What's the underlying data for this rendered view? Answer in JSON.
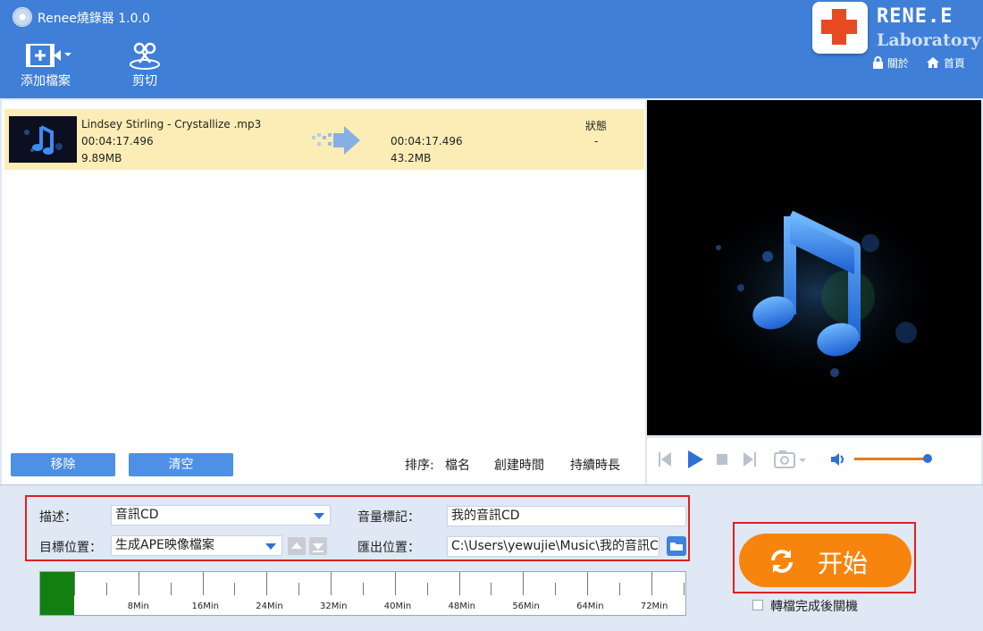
{
  "window": {
    "title": "Renee燒錄器 1.0.0"
  },
  "toolbar": {
    "add_label": "添加檔案",
    "cut_label": "剪切"
  },
  "brand": {
    "name": "RENE.E",
    "subtitle": "Laboratory",
    "about": "關於",
    "home": "首頁"
  },
  "file": {
    "name": "Lindsey Stirling - Crystallize .mp3",
    "duration": "00:04:17.496",
    "size": "9.89MB",
    "out_duration": "00:04:17.496",
    "out_size": "43.2MB",
    "status_header": "狀態",
    "status": "-"
  },
  "list_actions": {
    "remove": "移除",
    "clear": "清空"
  },
  "sort": {
    "label": "排序:",
    "name": "檔名",
    "created": "創建時間",
    "duration": "持續時長"
  },
  "player": {
    "volume_level": 0.97
  },
  "settings": {
    "desc_label": "描述：",
    "desc_value": "音訊CD",
    "volume_label_label": "音量標記：",
    "volume_label_value": "我的音訊CD",
    "target_label": "目標位置：",
    "target_value": "生成APE映像檔案",
    "output_label": "匯出位置：",
    "output_value": "C:\\Users\\yewujie\\Music\\我的音訊CD.ape"
  },
  "start": {
    "label": "开始"
  },
  "shutdown": {
    "label": "轉檔完成後關機",
    "checked": false
  },
  "timeline": {
    "ticks": [
      "8Min",
      "16Min",
      "24Min",
      "32Min",
      "40Min",
      "48Min",
      "56Min",
      "64Min",
      "72Min"
    ],
    "used_minutes": 4.3
  },
  "colors": {
    "header": "#3f7fd8",
    "accent": "#f7850d",
    "highlight": "#fbedb5",
    "used": "#118011"
  }
}
